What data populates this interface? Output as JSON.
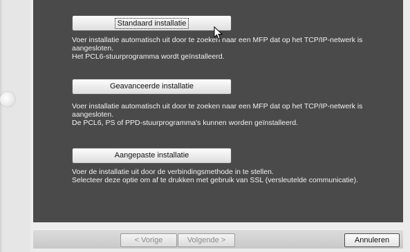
{
  "buttons": {
    "standard": "Standaard installatie",
    "advanced": "Geavanceerde installatie",
    "custom": "Aangepaste installatie"
  },
  "descriptions": {
    "standard": [
      "Voer installatie automatisch uit door te zoeken naar een MFP dat op het TCP/IP-netwerk is",
      "aangesloten.",
      "Het PCL6-stuurprogramma wordt geïnstalleerd."
    ],
    "advanced": [
      "Voer installatie automatisch uit door te zoeken naar een MFP dat op het TCP/IP-netwerk is",
      "aangesloten.",
      "De PCL6, PS of PPD-stuurprogramma's kunnen worden geïnstalleerd."
    ],
    "custom": [
      "Voer de installatie uit door de verbindingsmethode in te stellen.",
      "Selecteer deze optie om af te drukken met gebruik van SSL (versleutelde communicatie)."
    ]
  },
  "footer": {
    "back": "< Vorige",
    "next": "Volgende >",
    "cancel": "Annuleren"
  },
  "icons": {
    "cursor": "mouse-pointer-icon",
    "left_knob": "decorative-circle"
  }
}
